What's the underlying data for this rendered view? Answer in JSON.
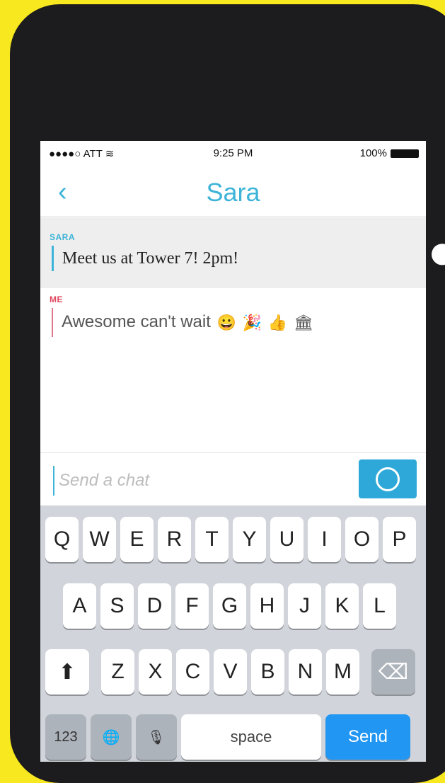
{
  "colors": {
    "background": "#f7e81f",
    "accent": "#3db4d8",
    "me": "#e0455e",
    "send": "#2196f3"
  },
  "status_bar": {
    "carrier": "●●●●○ ATT",
    "wifi_icon": "wifi-icon",
    "time": "9:25 PM",
    "battery": "100%"
  },
  "nav": {
    "back_icon": "chevron-left-icon",
    "title": "Sara"
  },
  "messages": [
    {
      "sender": "SARA",
      "text": "Meet us at Tower 7! 2pm!"
    },
    {
      "sender": "ME",
      "text": "Awesome can't wait",
      "emojis": [
        "😀",
        "🎉",
        "👍",
        "🏛"
      ]
    }
  ],
  "composer": {
    "placeholder": "Send a chat",
    "value": "",
    "camera_icon": "camera-shutter-icon"
  },
  "keyboard": {
    "row1": [
      "Q",
      "W",
      "E",
      "R",
      "T",
      "Y",
      "U",
      "I",
      "O",
      "P"
    ],
    "row2": [
      "A",
      "S",
      "D",
      "F",
      "G",
      "H",
      "J",
      "K",
      "L"
    ],
    "row3": [
      "Z",
      "X",
      "C",
      "V",
      "B",
      "N",
      "M"
    ],
    "shift_icon": "shift-icon",
    "delete_icon": "backspace-icon",
    "numbers_label": "123",
    "globe_icon": "globe-icon",
    "mic_icon": "microphone-icon",
    "space_label": "space",
    "send_label": "Send"
  }
}
